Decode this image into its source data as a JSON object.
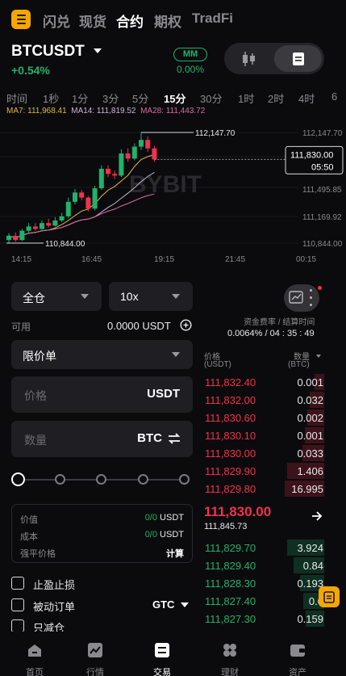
{
  "top_nav": {
    "tabs": [
      "闪兑",
      "现货",
      "合约",
      "期权",
      "TradFi"
    ],
    "active": "合约"
  },
  "header": {
    "symbol": "BTCUSDT",
    "change": "+0.54%",
    "mm_label": "MM",
    "mm_value": "0.00%"
  },
  "intervals": [
    "时间",
    "1秒",
    "1分",
    "3分",
    "5分",
    "15分",
    "30分",
    "1时",
    "2时",
    "4时",
    "6"
  ],
  "active_interval": "15分",
  "ma": {
    "ma7": "MA7: 111,968.41",
    "ma14": "MA14: 111,819.52",
    "ma28": "MA28: 111,443.72"
  },
  "chart_data": {
    "type": "candlestick",
    "price_labels": [
      "112,147.70",
      "111,495.85",
      "111,169.92",
      "110,844.00"
    ],
    "high_label": "112,147.70",
    "low_label": "110,844.00",
    "current_price": "111,830.00",
    "countdown": "05:50",
    "time_labels": [
      "14:15",
      "16:45",
      "19:15",
      "21:45",
      "00:15"
    ],
    "watermark": "BYBIT",
    "ylim": [
      110844.0,
      112147.7
    ],
    "candles": [
      {
        "o": 110880,
        "c": 110930,
        "h": 110960,
        "l": 110844
      },
      {
        "o": 110930,
        "c": 110880,
        "h": 110970,
        "l": 110860
      },
      {
        "o": 110880,
        "c": 110990,
        "h": 111010,
        "l": 110870
      },
      {
        "o": 110990,
        "c": 111040,
        "h": 111080,
        "l": 110970
      },
      {
        "o": 111040,
        "c": 111010,
        "h": 111080,
        "l": 110990
      },
      {
        "o": 111010,
        "c": 111080,
        "h": 111110,
        "l": 111000
      },
      {
        "o": 111080,
        "c": 111050,
        "h": 111130,
        "l": 111030
      },
      {
        "o": 111050,
        "c": 111110,
        "h": 111150,
        "l": 111040
      },
      {
        "o": 111110,
        "c": 111160,
        "h": 111200,
        "l": 111090
      },
      {
        "o": 111160,
        "c": 111330,
        "h": 111380,
        "l": 111140
      },
      {
        "o": 111330,
        "c": 111440,
        "h": 111480,
        "l": 111300
      },
      {
        "o": 111440,
        "c": 111380,
        "h": 111470,
        "l": 111350
      },
      {
        "o": 111380,
        "c": 111250,
        "h": 111400,
        "l": 111220
      },
      {
        "o": 111250,
        "c": 111490,
        "h": 111520,
        "l": 111230
      },
      {
        "o": 111490,
        "c": 111720,
        "h": 111760,
        "l": 111470
      },
      {
        "o": 111720,
        "c": 111660,
        "h": 111760,
        "l": 111620
      },
      {
        "o": 111660,
        "c": 111640,
        "h": 111700,
        "l": 111600
      },
      {
        "o": 111640,
        "c": 111900,
        "h": 111950,
        "l": 111620
      },
      {
        "o": 111900,
        "c": 111840,
        "h": 111960,
        "l": 111800
      },
      {
        "o": 111840,
        "c": 111980,
        "h": 112020,
        "l": 111820
      },
      {
        "o": 111980,
        "c": 112060,
        "h": 112147.7,
        "l": 111940
      },
      {
        "o": 112060,
        "c": 111960,
        "h": 112100,
        "l": 111920
      },
      {
        "o": 111960,
        "c": 111830,
        "h": 111990,
        "l": 111800
      }
    ]
  },
  "trade_panel": {
    "margin_mode": "全仓",
    "leverage": "10x",
    "available_label": "可用",
    "available_value": "0.0000 USDT",
    "order_type": "限价单",
    "price_placeholder": "价格",
    "price_unit": "USDT",
    "qty_placeholder": "数量",
    "qty_unit": "BTC",
    "summary": {
      "value_label": "价值",
      "value_amount": "0/0",
      "value_unit": "USDT",
      "cost_label": "成本",
      "cost_amount": "0/0",
      "cost_unit": "USDT",
      "liq_label": "强平价格",
      "liq_action": "计算"
    },
    "tp_sl_label": "止盈止损",
    "post_only_label": "被动订单",
    "tif": "GTC",
    "reduce_only_label": "只减仓"
  },
  "orderbook": {
    "funding_label": "资金费率 / 结算时间",
    "funding_value": "0.0064% / 04 : 35 : 49",
    "price_head": "价格",
    "price_unit": "(USDT)",
    "qty_head": "数量",
    "qty_unit": "(BTC)",
    "asks": [
      {
        "price": "111,832.40",
        "qty": "0.001",
        "depth": 0.08
      },
      {
        "price": "111,832.00",
        "qty": "0.032",
        "depth": 0.12
      },
      {
        "price": "111,830.60",
        "qty": "0.002",
        "depth": 0.14
      },
      {
        "price": "111,830.10",
        "qty": "0.001",
        "depth": 0.16
      },
      {
        "price": "111,830.00",
        "qty": "0.033",
        "depth": 0.18
      },
      {
        "price": "111,829.90",
        "qty": "1.406",
        "depth": 0.3
      },
      {
        "price": "111,829.80",
        "qty": "16.995",
        "depth": 0.32
      }
    ],
    "last_price": "111,830.00",
    "mark_price": "111,845.73",
    "bids": [
      {
        "price": "111,829.70",
        "qty": "3.924",
        "depth": 0.3
      },
      {
        "price": "111,829.40",
        "qty": "0.84",
        "depth": 0.25
      },
      {
        "price": "111,828.30",
        "qty": "0.193",
        "depth": 0.2
      },
      {
        "price": "111,827.40",
        "qty": "0.0",
        "depth": 0.17
      },
      {
        "price": "111,827.30",
        "qty": "0.159",
        "depth": 0.15
      }
    ]
  },
  "bottom_nav": [
    {
      "label": "首页",
      "icon": "home-icon"
    },
    {
      "label": "行情",
      "icon": "chart-icon"
    },
    {
      "label": "交易",
      "icon": "trade-icon"
    },
    {
      "label": "理财",
      "icon": "earn-icon"
    },
    {
      "label": "资产",
      "icon": "wallet-icon"
    }
  ],
  "bottom_nav_active": "交易",
  "colors": {
    "up": "#20b26c",
    "down": "#f1314d",
    "accent": "#f7a600"
  }
}
